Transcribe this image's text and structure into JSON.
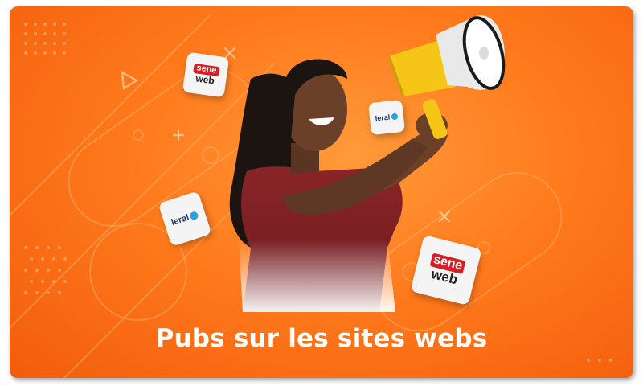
{
  "banner": {
    "caption": "Pubs sur les sites webs"
  },
  "logos": {
    "seneweb_top": "sene",
    "seneweb_bottom": "web",
    "leral_text": "leral"
  },
  "colors": {
    "background_main": "#ff7a1c",
    "background_light": "#ff9a3a",
    "caption_text": "#ffffff",
    "seneweb_red": "#d81e25",
    "leral_blue": "#1a3a6b",
    "megaphone_yellow": "#f5c518",
    "shirt": "#7a1f24"
  },
  "icons": [
    "megaphone-icon",
    "seneweb-logo",
    "leral-logo"
  ]
}
